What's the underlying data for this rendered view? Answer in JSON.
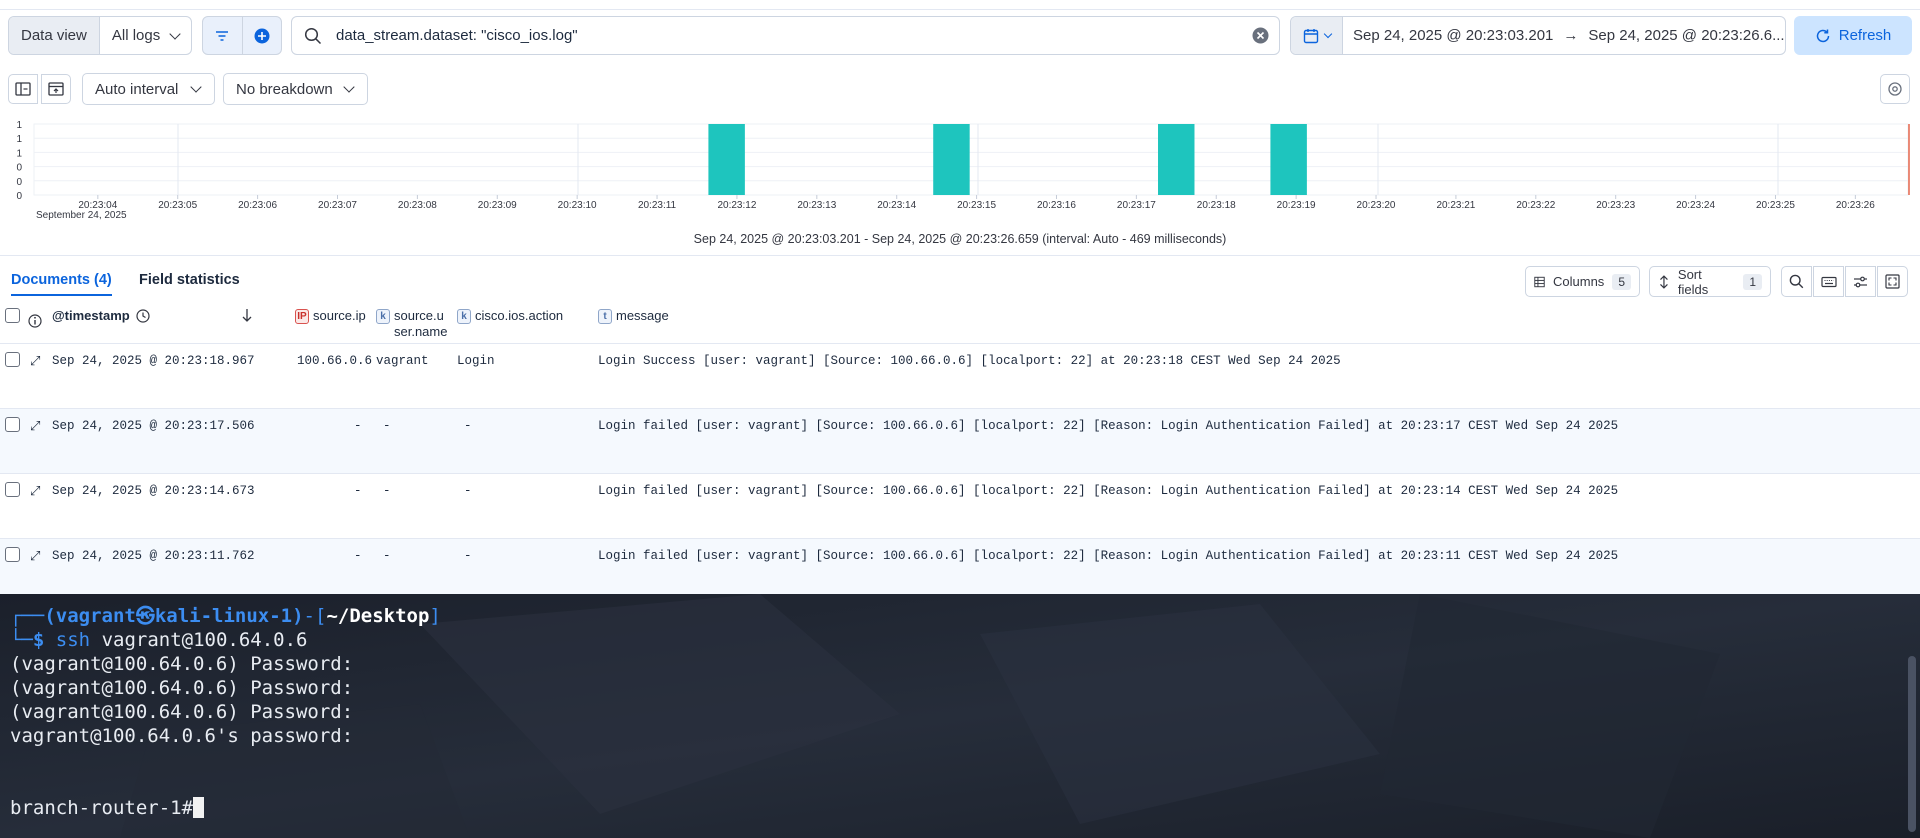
{
  "query_bar": {
    "data_view_label": "Data view",
    "data_view_value": "All logs",
    "query": "data_stream.dataset: \"cisco_ios.log\"",
    "date_start": "Sep 24, 2025 @ 20:23:03.201",
    "date_end": "Sep 24, 2025 @ 20:23:26.6...",
    "refresh_label": "Refresh"
  },
  "toolbar": {
    "interval_label": "Auto interval",
    "breakdown_label": "No breakdown"
  },
  "histogram": {
    "y_ticks": [
      "1",
      "1",
      "1",
      "0",
      "0",
      "0"
    ],
    "x_ticks": [
      "20:23:04",
      "20:23:05",
      "20:23:06",
      "20:23:07",
      "20:23:08",
      "20:23:09",
      "20:23:10",
      "20:23:11",
      "20:23:12",
      "20:23:13",
      "20:23:14",
      "20:23:15",
      "20:23:16",
      "20:23:17",
      "20:23:18",
      "20:23:19",
      "20:23:20",
      "20:23:21",
      "20:23:22",
      "20:23:23",
      "20:23:24",
      "20:23:25",
      "20:23:26"
    ],
    "x_date": "September 24, 2025",
    "caption": "Sep 24, 2025 @ 20:23:03.201 - Sep 24, 2025 @ 20:23:26.659 (interval: Auto - 469 milliseconds)",
    "bar_color": "#1ec5be"
  },
  "chart_data": {
    "type": "bar",
    "x": [
      "20:23:11.762",
      "20:23:14.673",
      "20:23:17.506",
      "20:23:18.967"
    ],
    "values": [
      1,
      1,
      1,
      1
    ],
    "ylim": [
      0,
      1
    ],
    "xlabel": "September 24, 2025",
    "ylabel": ""
  },
  "tabs": {
    "documents": "Documents (4)",
    "field_statistics": "Field statistics"
  },
  "grid_toolbar": {
    "columns_label": "Columns",
    "columns_count": "5",
    "sort_label": "Sort fields",
    "sort_count": "1"
  },
  "columns": {
    "timestamp": "@timestamp",
    "source_ip": "source.ip",
    "source_user": "source.u\nser.name",
    "action": "cisco.ios.action",
    "message": "message"
  },
  "rows": [
    {
      "timestamp": "Sep 24, 2025 @ 20:23:18.967",
      "ip": "100.66.0.6",
      "user": "vagrant",
      "action": "Login",
      "message": "Login Success [user: vagrant] [Source: 100.66.0.6] [localport: 22] at 20:23:18 CEST Wed Sep 24 2025"
    },
    {
      "timestamp": "Sep 24, 2025 @ 20:23:17.506",
      "ip": "-",
      "user": "-",
      "action": "-",
      "message": "Login failed [user: vagrant] [Source: 100.66.0.6] [localport: 22] [Reason: Login Authentication Failed] at 20:23:17 CEST Wed Sep 24 2025"
    },
    {
      "timestamp": "Sep 24, 2025 @ 20:23:14.673",
      "ip": "-",
      "user": "-",
      "action": "-",
      "message": "Login failed [user: vagrant] [Source: 100.66.0.6] [localport: 22] [Reason: Login Authentication Failed] at 20:23:14 CEST Wed Sep 24 2025"
    },
    {
      "timestamp": "Sep 24, 2025 @ 20:23:11.762",
      "ip": "-",
      "user": "-",
      "action": "-",
      "message": "Login failed [user: vagrant] [Source: 100.66.0.6] [localport: 22] [Reason: Login Authentication Failed] at 20:23:11 CEST Wed Sep 24 2025"
    }
  ],
  "terminal": {
    "prompt_user": "(vagrant㉿kali-linux-1)",
    "prompt_dir": "~/Desktop",
    "command": "ssh vagrant@100.64.0.6",
    "lines": [
      "(vagrant@100.64.0.6) Password:",
      "(vagrant@100.64.0.6) Password:",
      "(vagrant@100.64.0.6) Password:",
      "vagrant@100.64.0.6's password:"
    ],
    "router_prompt": "branch-router-1#"
  }
}
